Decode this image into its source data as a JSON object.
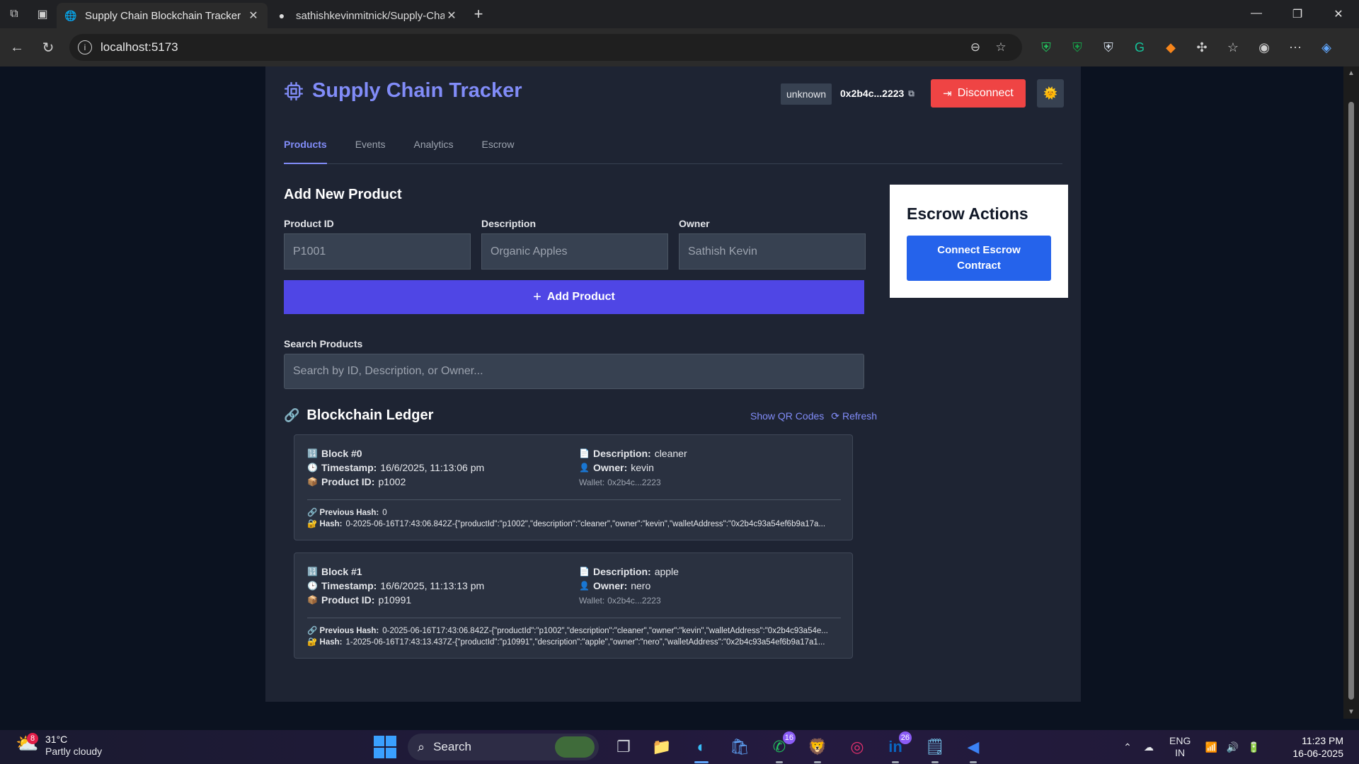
{
  "browser": {
    "tabs": [
      {
        "title": "Supply Chain Blockchain Tracker",
        "active": true
      },
      {
        "title": "sathishkevinmitnick/Supply-Chain",
        "active": false
      }
    ],
    "url": "localhost:5173"
  },
  "app": {
    "brand": "Supply Chain Tracker",
    "network": "unknown",
    "wallet": "0x2b4c...2223",
    "disconnect_label": "Disconnect",
    "tabs": [
      "Products",
      "Events",
      "Analytics",
      "Escrow"
    ],
    "active_tab": "Products",
    "form": {
      "title": "Add New Product",
      "product_id_label": "Product ID",
      "product_id_placeholder": "P1001",
      "description_label": "Description",
      "description_placeholder": "Organic Apples",
      "owner_label": "Owner",
      "owner_placeholder": "Sathish Kevin",
      "add_button": "Add Product"
    },
    "search": {
      "label": "Search Products",
      "placeholder": "Search by ID, Description, or Owner..."
    },
    "ledger": {
      "title": "Blockchain Ledger",
      "show_qr": "Show QR Codes",
      "refresh": "Refresh",
      "blocks": [
        {
          "block": "Block #0",
          "timestamp": "16/6/2025, 11:13:06 pm",
          "product_id": "p1002",
          "description": "cleaner",
          "owner": "kevin",
          "wallet": "0x2b4c...2223",
          "previous_hash": "0",
          "hash": "0-2025-06-16T17:43:06.842Z-{\"productId\":\"p1002\",\"description\":\"cleaner\",\"owner\":\"kevin\",\"walletAddress\":\"0x2b4c93a54ef6b9a17a..."
        },
        {
          "block": "Block #1",
          "timestamp": "16/6/2025, 11:13:13 pm",
          "product_id": "p10991",
          "description": "apple",
          "owner": "nero",
          "wallet": "0x2b4c...2223",
          "previous_hash": "0-2025-06-16T17:43:06.842Z-{\"productId\":\"p1002\",\"description\":\"cleaner\",\"owner\":\"kevin\",\"walletAddress\":\"0x2b4c93a54e...",
          "hash": "1-2025-06-16T17:43:13.437Z-{\"productId\":\"p10991\",\"description\":\"apple\",\"owner\":\"nero\",\"walletAddress\":\"0x2b4c93a54ef6b9a17a1..."
        }
      ],
      "labels": {
        "timestamp": "Timestamp:",
        "product_id": "Product ID:",
        "description": "Description:",
        "owner": "Owner:",
        "wallet": "Wallet:",
        "previous_hash": "Previous Hash:",
        "hash": "Hash:"
      }
    },
    "escrow": {
      "title": "Escrow Actions",
      "button": "Connect Escrow Contract"
    }
  },
  "taskbar": {
    "weather_temp": "31°C",
    "weather_desc": "Partly cloudy",
    "weather_badge": "8",
    "search": "Search",
    "whatsapp_badge": "16",
    "linkedin_badge": "26",
    "lang_top": "ENG",
    "lang_bottom": "IN",
    "time": "11:23 PM",
    "date": "16-06-2025"
  },
  "colors": {
    "accent": "#818cf8",
    "primary_button": "#4f46e5",
    "disconnect": "#ef4444",
    "escrow_button": "#2563eb"
  }
}
